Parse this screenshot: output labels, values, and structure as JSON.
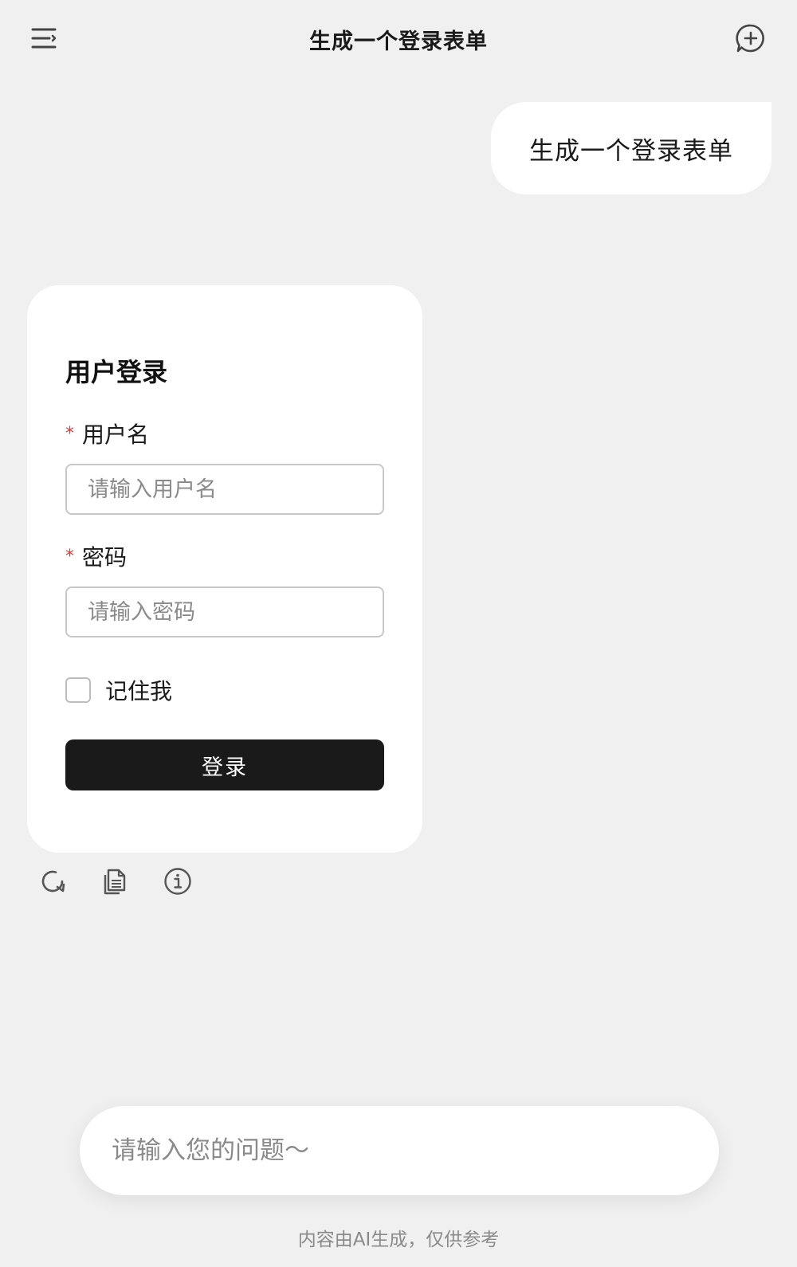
{
  "header": {
    "title": "生成一个登录表单",
    "menu_icon": "menu-icon",
    "new_chat_icon": "new-chat-icon"
  },
  "conversation": {
    "user_message": "生成一个登录表单",
    "form": {
      "title": "用户登录",
      "required_mark": "*",
      "username_label": "用户名",
      "username_placeholder": "请输入用户名",
      "password_label": "密码",
      "password_placeholder": "请输入密码",
      "remember_label": "记住我",
      "login_label": "登录"
    },
    "actions": [
      "refresh-icon",
      "copy-icon",
      "info-icon"
    ]
  },
  "composer": {
    "placeholder": "请输入您的问题～",
    "disclaimer": "内容由AI生成，仅供参考"
  },
  "colors": {
    "background": "#f0f0f0",
    "button": "#1a1a1a",
    "required": "#e53935"
  }
}
